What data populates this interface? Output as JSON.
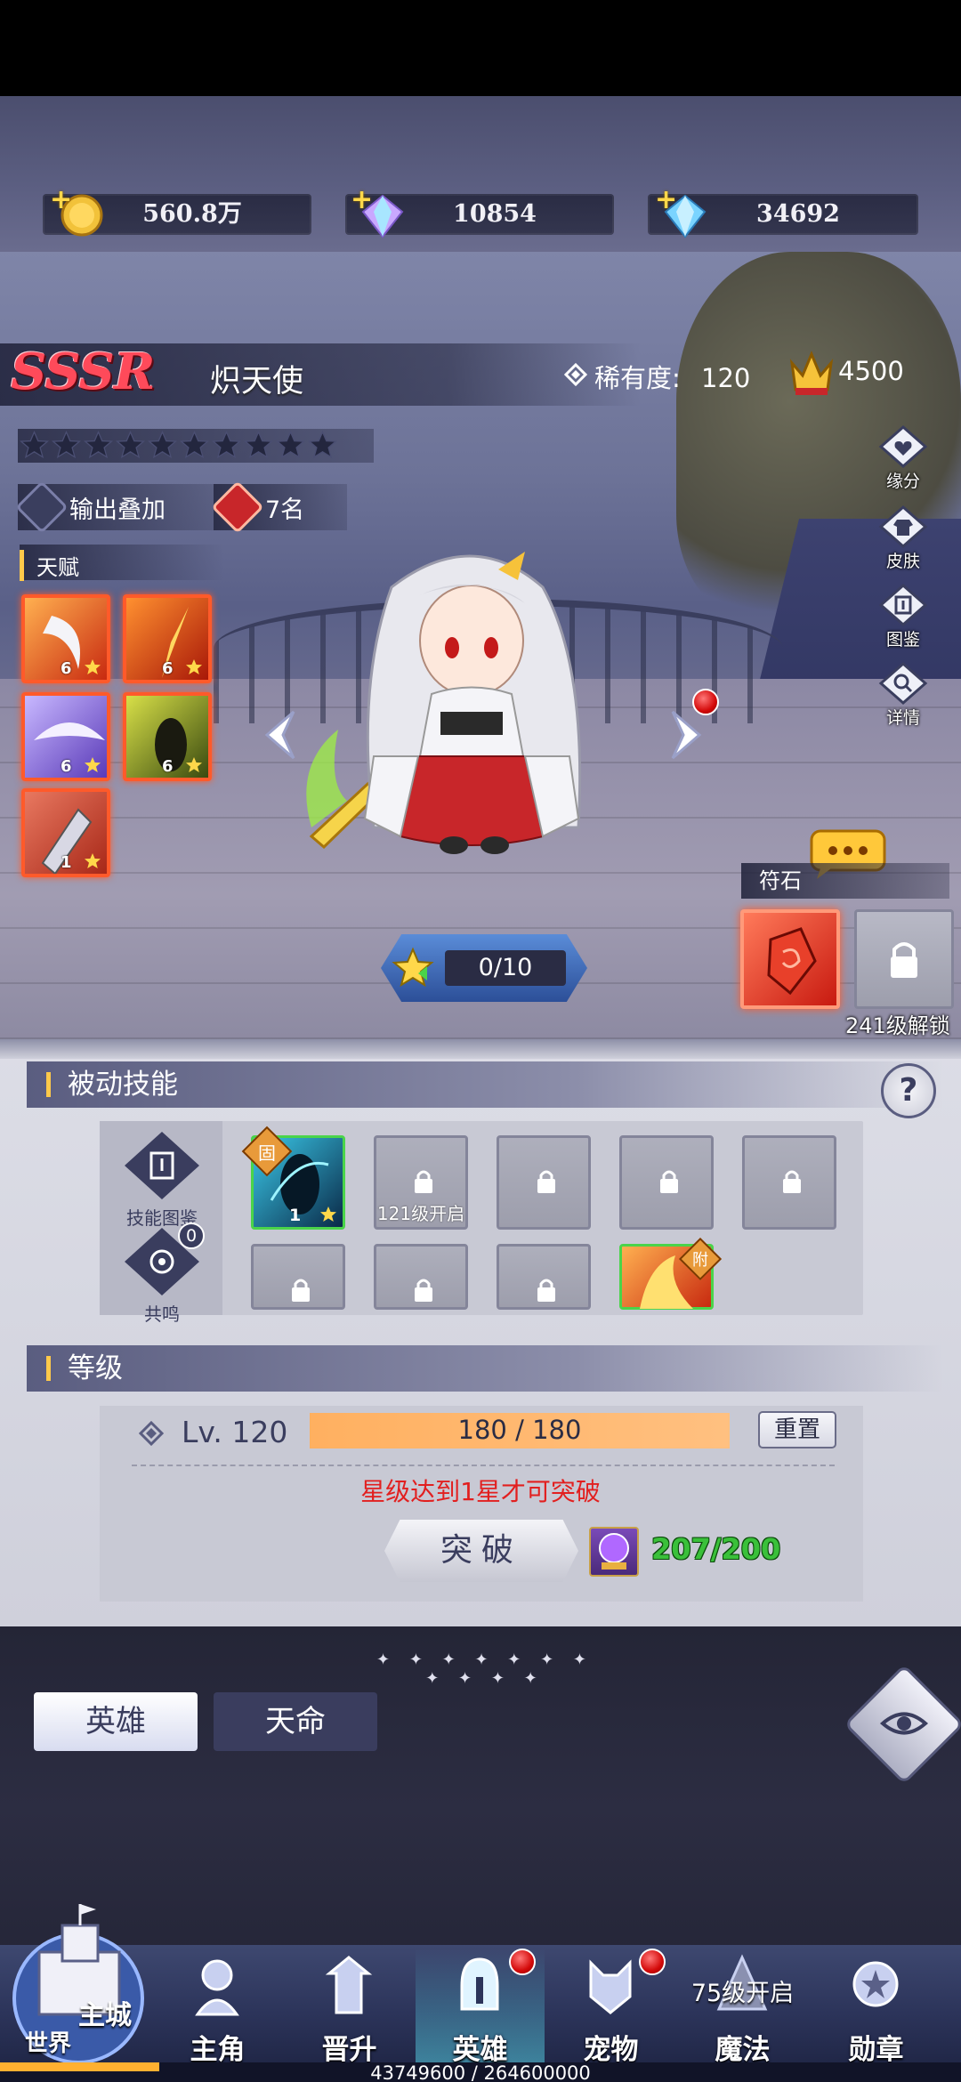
{
  "resources": {
    "gold": "560.8万",
    "gems": "10854",
    "diamonds": "34692"
  },
  "hero": {
    "rarity_badge": "SSSR",
    "name": "炽天使",
    "rarity_label": "稀有度:",
    "rarity_value": "120",
    "crown_value": "4500",
    "star_count": 10,
    "tags": [
      {
        "label": "输出叠加"
      },
      {
        "label": "7名"
      }
    ],
    "talent_title": "天赋",
    "talents": [
      {
        "level": "6"
      },
      {
        "level": "6"
      },
      {
        "level": "6"
      },
      {
        "level": "6"
      },
      {
        "level": "1"
      }
    ],
    "exp_progress": "0/10"
  },
  "side_menu": [
    {
      "label": "缘分",
      "icon": "heart-icon"
    },
    {
      "label": "皮肤",
      "icon": "outfit-icon"
    },
    {
      "label": "图鉴",
      "icon": "book-icon"
    },
    {
      "label": "详情",
      "icon": "magnifier-icon"
    }
  ],
  "rune": {
    "title": "符石",
    "locked_label": "241级解锁"
  },
  "passive": {
    "title": "被动技能",
    "help": "?",
    "tools": [
      {
        "label": "技能图鉴"
      },
      {
        "label": "共鸣",
        "badge": "0"
      }
    ],
    "equipped_level": "1",
    "equipped_tag": "固",
    "locked_slot_caption": "121级开启",
    "last_tag": "附"
  },
  "level": {
    "title": "等级",
    "lv_text": "Lv. 120",
    "exp_text": "180 / 180",
    "exp_fraction": 1.0,
    "reset_label": "重置",
    "warning": "星级达到1星才可突破",
    "break_label": "突破",
    "material_count": "207/200"
  },
  "bottom": {
    "deco": "✦ ✦ ✦ ✦ ✦ ✦ ✦ ✦ ✦ ✦ ✦",
    "tabs": [
      {
        "label": "英雄",
        "active": true
      },
      {
        "label": "天命",
        "active": false
      }
    ]
  },
  "nav": {
    "main_city": "主城",
    "world": "世界",
    "items": [
      {
        "label": "主角"
      },
      {
        "label": "晋升"
      },
      {
        "label": "英雄"
      },
      {
        "label": "宠物"
      },
      {
        "label": "魔法",
        "note": "75级开启"
      },
      {
        "label": "勋章"
      }
    ],
    "exp_progress": "43749600 / 264600000"
  },
  "colors": {
    "accent_red": "#e21f1f",
    "accent_green": "#3ac03a",
    "exp_bar": "#ffb060",
    "talent_border": "#ff5a2a"
  }
}
